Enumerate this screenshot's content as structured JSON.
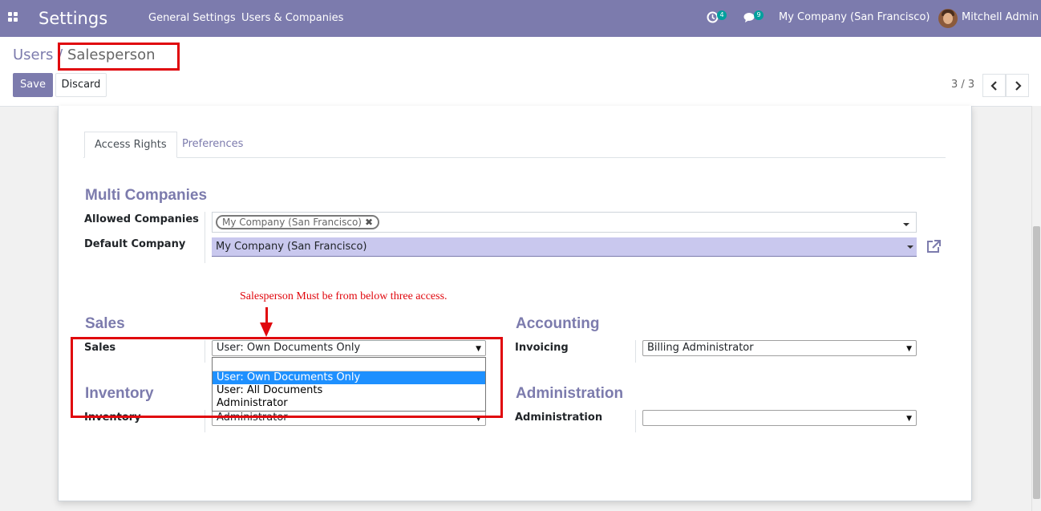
{
  "navbar": {
    "app_title": "Settings",
    "menu": [
      "General Settings",
      "Users & Companies"
    ],
    "activity_count": "4",
    "messages_count": "9",
    "company": "My Company (San Francisco)",
    "user": "Mitchell Admin"
  },
  "breadcrumb": {
    "parent": "Users",
    "separator": "/",
    "current": "Salesperson"
  },
  "toolbar": {
    "save": "Save",
    "discard": "Discard",
    "pager": "3 / 3"
  },
  "tabs": [
    "Access Rights",
    "Preferences"
  ],
  "multi_companies": {
    "title": "Multi Companies",
    "allowed_label": "Allowed Companies",
    "allowed_tag": "My Company (San Francisco)",
    "default_label": "Default Company",
    "default_value": "My Company (San Francisco)"
  },
  "annotation": "Salesperson Must be from below three access.",
  "sales": {
    "title": "Sales",
    "label": "Sales",
    "value": "User: Own Documents Only",
    "options": [
      "User: Own Documents Only",
      "User: All Documents",
      "Administrator"
    ]
  },
  "accounting": {
    "title": "Accounting",
    "label": "Invoicing",
    "value": "Billing Administrator"
  },
  "inventory": {
    "title": "Inventory",
    "label": "Inventory",
    "value": "Administrator"
  },
  "administration": {
    "title": "Administration",
    "label": "Administration",
    "value": ""
  },
  "colors": {
    "brand": "#7c7bad",
    "badge": "#00a09d",
    "highlight": "#e0070d",
    "selected_option": "#1e90ff"
  }
}
